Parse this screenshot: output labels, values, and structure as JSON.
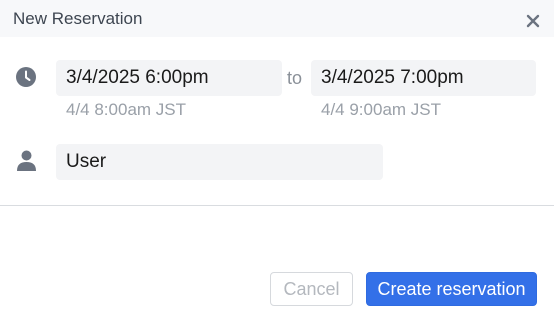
{
  "dialog": {
    "title": "New Reservation",
    "close_icon": "close-icon"
  },
  "time": {
    "icon": "clock-icon",
    "start_value": "3/4/2025 6:00pm",
    "start_sub": "4/4 8:00am JST",
    "separator": "to",
    "end_value": "3/4/2025 7:00pm",
    "end_sub": "4/4 9:00am JST"
  },
  "user": {
    "icon": "user-icon",
    "value": "User"
  },
  "actions": {
    "cancel_label": "Cancel",
    "create_label": "Create reservation"
  },
  "colors": {
    "primary": "#3370e8",
    "header_bg": "#f7f8fa",
    "field_bg": "#f3f4f6",
    "icon": "#6b7380"
  }
}
